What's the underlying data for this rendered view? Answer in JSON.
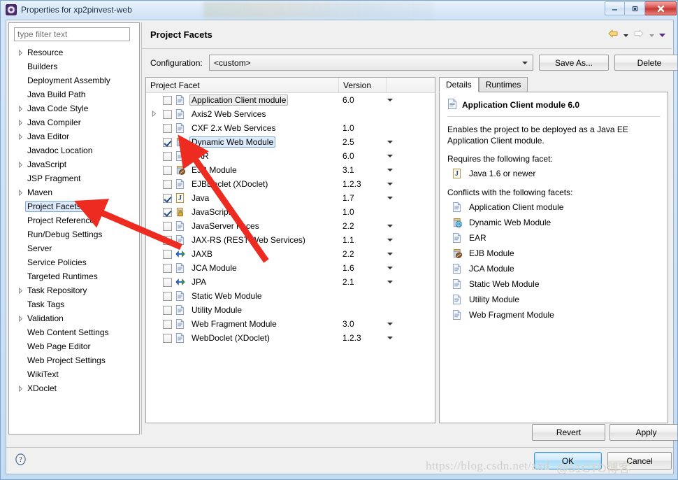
{
  "window": {
    "title": "Properties for xp2pinvest-web",
    "icon": "eclipse-properties-icon",
    "minimize_label": "—",
    "maximize_label": "❐",
    "close_label": "✕"
  },
  "sidebar": {
    "filter_placeholder": "type filter text",
    "filter_value": "",
    "items": [
      {
        "label": "Resource",
        "expandable": true,
        "selected": false
      },
      {
        "label": "Builders",
        "expandable": false,
        "selected": false
      },
      {
        "label": "Deployment Assembly",
        "expandable": false,
        "selected": false
      },
      {
        "label": "Java Build Path",
        "expandable": false,
        "selected": false
      },
      {
        "label": "Java Code Style",
        "expandable": true,
        "selected": false
      },
      {
        "label": "Java Compiler",
        "expandable": true,
        "selected": false
      },
      {
        "label": "Java Editor",
        "expandable": true,
        "selected": false
      },
      {
        "label": "Javadoc Location",
        "expandable": false,
        "selected": false
      },
      {
        "label": "JavaScript",
        "expandable": true,
        "selected": false
      },
      {
        "label": "JSP Fragment",
        "expandable": false,
        "selected": false
      },
      {
        "label": "Maven",
        "expandable": true,
        "selected": false
      },
      {
        "label": "Project Facets",
        "expandable": false,
        "selected": true
      },
      {
        "label": "Project References",
        "expandable": false,
        "selected": false
      },
      {
        "label": "Run/Debug Settings",
        "expandable": false,
        "selected": false
      },
      {
        "label": "Server",
        "expandable": false,
        "selected": false
      },
      {
        "label": "Service Policies",
        "expandable": false,
        "selected": false
      },
      {
        "label": "Targeted Runtimes",
        "expandable": false,
        "selected": false
      },
      {
        "label": "Task Repository",
        "expandable": true,
        "selected": false
      },
      {
        "label": "Task Tags",
        "expandable": false,
        "selected": false
      },
      {
        "label": "Validation",
        "expandable": true,
        "selected": false
      },
      {
        "label": "Web Content Settings",
        "expandable": false,
        "selected": false
      },
      {
        "label": "Web Page Editor",
        "expandable": false,
        "selected": false
      },
      {
        "label": "Web Project Settings",
        "expandable": false,
        "selected": false
      },
      {
        "label": "WikiText",
        "expandable": false,
        "selected": false
      },
      {
        "label": "XDoclet",
        "expandable": true,
        "selected": false
      }
    ]
  },
  "page": {
    "title": "Project Facets",
    "nav": {
      "back_icon": "back-arrow-icon",
      "back_menu_icon": "chevron-down-icon",
      "forward_icon": "forward-arrow-icon",
      "forward_menu_icon": "chevron-down-icon",
      "menu_icon": "chevron-down-icon"
    }
  },
  "configuration": {
    "label": "Configuration:",
    "value": "<custom>",
    "dropdown_icon": "chevron-down-icon",
    "save_as_label": "Save As...",
    "delete_label": "Delete"
  },
  "facets_table": {
    "columns": [
      "Project Facet",
      "Version",
      ""
    ],
    "rows": [
      {
        "name": "Application Client module",
        "version": "6.0",
        "checked": false,
        "icon": "document-icon",
        "expandable": false,
        "has_version_dropdown": true,
        "state": "outlined"
      },
      {
        "name": "Axis2 Web Services",
        "version": "",
        "checked": false,
        "icon": "document-icon",
        "expandable": true,
        "has_version_dropdown": false,
        "state": ""
      },
      {
        "name": "CXF 2.x Web Services",
        "version": "1.0",
        "checked": false,
        "icon": "document-icon",
        "expandable": false,
        "has_version_dropdown": false,
        "state": ""
      },
      {
        "name": "Dynamic Web Module",
        "version": "2.5",
        "checked": true,
        "icon": "web-module-icon",
        "expandable": false,
        "has_version_dropdown": true,
        "state": "highlight"
      },
      {
        "name": "EAR",
        "version": "6.0",
        "checked": false,
        "icon": "document-icon",
        "expandable": false,
        "has_version_dropdown": true,
        "state": ""
      },
      {
        "name": "EJB Module",
        "version": "3.1",
        "checked": false,
        "icon": "ejb-module-icon",
        "expandable": false,
        "has_version_dropdown": true,
        "state": ""
      },
      {
        "name": "EJBDoclet (XDoclet)",
        "version": "1.2.3",
        "checked": false,
        "icon": "document-icon",
        "expandable": false,
        "has_version_dropdown": true,
        "state": ""
      },
      {
        "name": "Java",
        "version": "1.7",
        "checked": true,
        "icon": "java-icon",
        "expandable": false,
        "has_version_dropdown": true,
        "state": ""
      },
      {
        "name": "JavaScript",
        "version": "1.0",
        "checked": true,
        "icon": "javascript-icon",
        "expandable": false,
        "has_version_dropdown": false,
        "state": ""
      },
      {
        "name": "JavaServer Faces",
        "version": "2.2",
        "checked": false,
        "icon": "document-icon",
        "expandable": false,
        "has_version_dropdown": true,
        "state": ""
      },
      {
        "name": "JAX-RS (REST Web Services)",
        "version": "1.1",
        "checked": false,
        "icon": "document-icon",
        "expandable": false,
        "has_version_dropdown": true,
        "state": ""
      },
      {
        "name": "JAXB",
        "version": "2.2",
        "checked": false,
        "icon": "jaxb-icon",
        "expandable": false,
        "has_version_dropdown": true,
        "state": ""
      },
      {
        "name": "JCA Module",
        "version": "1.6",
        "checked": false,
        "icon": "document-icon",
        "expandable": false,
        "has_version_dropdown": true,
        "state": ""
      },
      {
        "name": "JPA",
        "version": "2.1",
        "checked": false,
        "icon": "jpa-icon",
        "expandable": false,
        "has_version_dropdown": true,
        "state": ""
      },
      {
        "name": "Static Web Module",
        "version": "",
        "checked": false,
        "icon": "document-icon",
        "expandable": false,
        "has_version_dropdown": false,
        "state": ""
      },
      {
        "name": "Utility Module",
        "version": "",
        "checked": false,
        "icon": "document-icon",
        "expandable": false,
        "has_version_dropdown": false,
        "state": ""
      },
      {
        "name": "Web Fragment Module",
        "version": "3.0",
        "checked": false,
        "icon": "document-icon",
        "expandable": false,
        "has_version_dropdown": true,
        "state": ""
      },
      {
        "name": "WebDoclet (XDoclet)",
        "version": "1.2.3",
        "checked": false,
        "icon": "document-icon",
        "expandable": false,
        "has_version_dropdown": true,
        "state": ""
      }
    ]
  },
  "details": {
    "tabs": [
      {
        "label": "Details",
        "active": true
      },
      {
        "label": "Runtimes",
        "active": false
      }
    ],
    "heading": "Application Client module 6.0",
    "heading_icon": "document-icon",
    "description": "Enables the project to be deployed as a Java EE Application Client module.",
    "requires_label": "Requires the following facet:",
    "requires": [
      {
        "label": "Java 1.6 or newer",
        "icon": "java-icon"
      }
    ],
    "conflicts_label": "Conflicts with the following facets:",
    "conflicts": [
      {
        "label": "Application Client module",
        "icon": "document-icon"
      },
      {
        "label": "Dynamic Web Module",
        "icon": "web-module-icon"
      },
      {
        "label": "EAR",
        "icon": "document-icon"
      },
      {
        "label": "EJB Module",
        "icon": "ejb-module-icon"
      },
      {
        "label": "JCA Module",
        "icon": "document-icon"
      },
      {
        "label": "Static Web Module",
        "icon": "document-icon"
      },
      {
        "label": "Utility Module",
        "icon": "document-icon"
      },
      {
        "label": "Web Fragment Module",
        "icon": "document-icon"
      }
    ]
  },
  "buttons": {
    "revert": "Revert",
    "apply": "Apply",
    "ok": "OK",
    "cancel": "Cancel",
    "help_icon": "help-question-icon"
  },
  "watermark": {
    "url": "https://blog.csdn.net/zxd",
    "overlay": "@51CTO博客"
  },
  "annotations": {
    "color": "#ee2b21",
    "arrows": [
      {
        "target": "sidebar-item-project-facets"
      },
      {
        "target": "facet-row-dynamic-web-module"
      }
    ]
  }
}
